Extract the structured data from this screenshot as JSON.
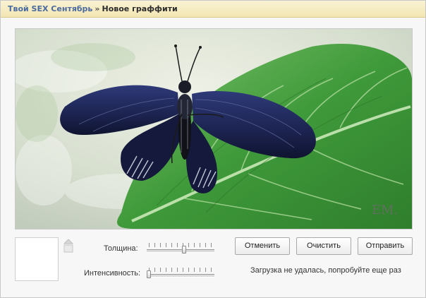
{
  "breadcrumb": {
    "community": "Твой SEX Сентябрь",
    "separator": "»",
    "current": "Новое граффити"
  },
  "canvas": {
    "signature": "ЕМ."
  },
  "brush": {
    "thickness_label": "Толщина:",
    "thickness_value": 0.55,
    "intensity_label": "Интенсивность:",
    "intensity_value": 0.0
  },
  "actions": {
    "cancel": "Отменить",
    "clear": "Очистить",
    "send": "Отправить"
  },
  "status": "Загрузка не удалась, попробуйте еще раз",
  "colors": {
    "header_bg": "#f3e6b4",
    "link": "#4a6aa0",
    "leaf": "#3f9a3a",
    "wing": "#1c2350"
  }
}
